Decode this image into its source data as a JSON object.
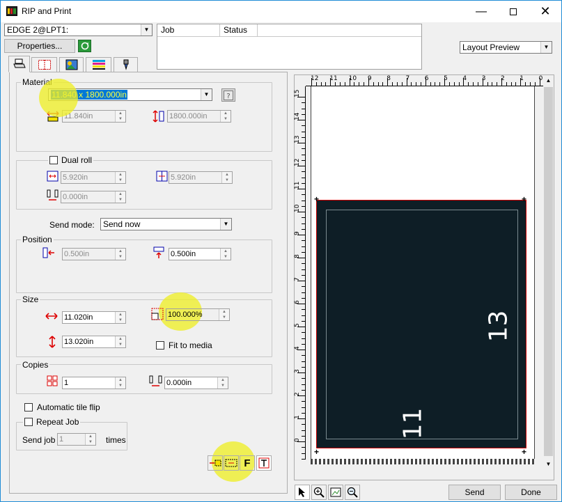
{
  "window": {
    "title": "RIP and Print"
  },
  "printer": {
    "selected": "EDGE 2@LPT1:"
  },
  "properties_button": "Properties...",
  "queue": {
    "col_job": "Job",
    "col_status": "Status"
  },
  "preview_mode": "Layout Preview",
  "material": {
    "label": "Material",
    "selected": "11.840 x 1800.000in",
    "width": "11.840in",
    "length": "1800.000in"
  },
  "dual_roll": {
    "label": "Dual roll",
    "left": "5.920in",
    "right": "5.920in",
    "gap": "0.000in"
  },
  "send_mode": {
    "label": "Send mode:",
    "value": "Send now"
  },
  "position": {
    "label": "Position",
    "x": "0.500in",
    "y": "0.500in"
  },
  "size": {
    "label": "Size",
    "width": "11.020in",
    "height": "13.020in",
    "scale": "100.000%",
    "fit_label": "Fit to media"
  },
  "copies": {
    "label": "Copies",
    "count": "1",
    "spacing": "0.000in"
  },
  "auto_tile_flip": "Automatic tile flip",
  "repeat_job": {
    "label": "Repeat Job",
    "send_job_label": "Send job",
    "value": "1",
    "times_label": "times"
  },
  "bottom_tools": {
    "f_label": "F"
  },
  "ruler": {
    "top_ticks": [
      "12",
      "11",
      "10",
      "9",
      "8",
      "7",
      "6",
      "5",
      "4",
      "3",
      "2",
      "1",
      "0"
    ],
    "left_ticks": [
      "15",
      "14",
      "13",
      "12",
      "11",
      "10",
      "9",
      "8",
      "7",
      "6",
      "5",
      "4",
      "3",
      "2",
      "1",
      "0"
    ]
  },
  "preview": {
    "dim_horizontal": "11",
    "dim_vertical": "13",
    "page_color": "#0e1e26"
  },
  "actions": {
    "send": "Send",
    "done": "Done"
  }
}
